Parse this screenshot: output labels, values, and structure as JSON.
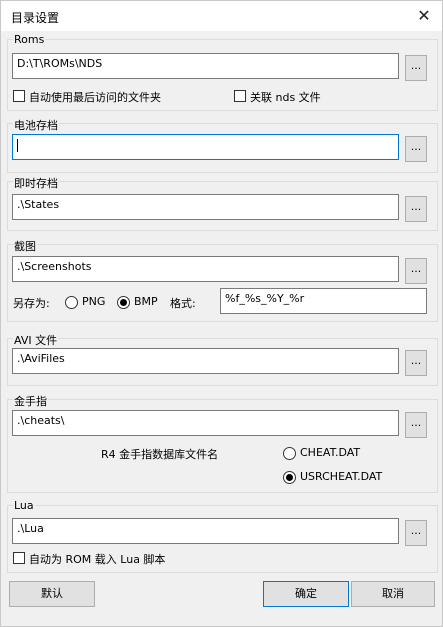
{
  "window": {
    "title": "目录设置",
    "close_glyph": "✕"
  },
  "roms": {
    "label": "Roms",
    "path": "D:\\T\\ROMs\\NDS",
    "browse_label": "...",
    "checkbox_auto_last": "自动使用最后访问的文件夹",
    "checkbox_assoc": "关联 nds 文件"
  },
  "battery": {
    "label": "电池存档",
    "path": "",
    "browse_label": "..."
  },
  "savestate": {
    "label": "即时存档",
    "path": ".\\States",
    "browse_label": "..."
  },
  "screenshot": {
    "label": "截图",
    "path": ".\\Screenshots",
    "browse_label": "...",
    "save_as_label": "另存为:",
    "format_png": "PNG",
    "format_bmp": "BMP",
    "selected_format": "BMP",
    "format_label": "格式:",
    "format_value": "%f_%s_%Y_%r"
  },
  "avi": {
    "label": "AVI 文件",
    "path": ".\\AviFiles",
    "browse_label": "..."
  },
  "cheats": {
    "label": "金手指",
    "path": ".\\cheats\\",
    "browse_label": "...",
    "db_label": "R4 金手指数据库文件名",
    "option_cheat": "CHEAT.DAT",
    "option_usrcheat": "USRCHEAT.DAT",
    "selected": "USRCHEAT.DAT"
  },
  "lua": {
    "label": "Lua",
    "path": ".\\Lua",
    "browse_label": "...",
    "checkbox_autoload": "自动为 ROM 载入 Lua 脚本"
  },
  "buttons": {
    "default": "默认",
    "ok": "确定",
    "cancel": "取消"
  }
}
